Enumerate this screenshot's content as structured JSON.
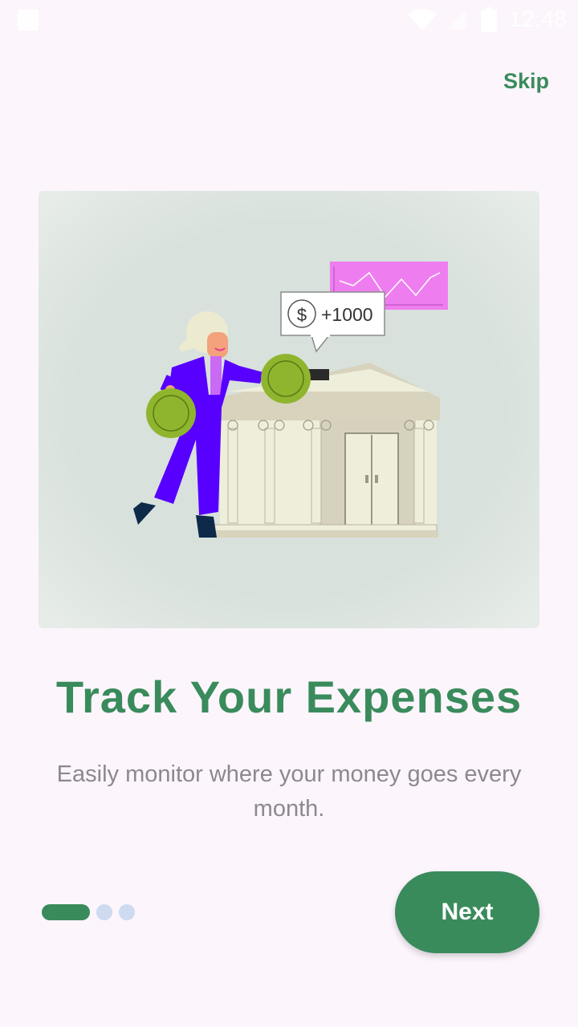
{
  "status_bar": {
    "time": "12:48",
    "icons": [
      "notification-icon",
      "wifi-icon",
      "signal-icon",
      "battery-icon"
    ]
  },
  "onboarding": {
    "skip_label": "Skip",
    "illustration": {
      "bubble_text": "+1000",
      "currency_symbol": "$"
    },
    "title": "Track Your Expenses",
    "subtitle": "Easily monitor where your money goes every month.",
    "page_indicator": {
      "current_page": 1,
      "total_pages": 3
    },
    "next_label": "Next"
  },
  "colors": {
    "primary": "#3a8b5c",
    "background": "#fcf5fc",
    "subtitle": "#8d8790",
    "dot_inactive": "#cddaf0",
    "illustration_bg": "#dbe3de"
  }
}
